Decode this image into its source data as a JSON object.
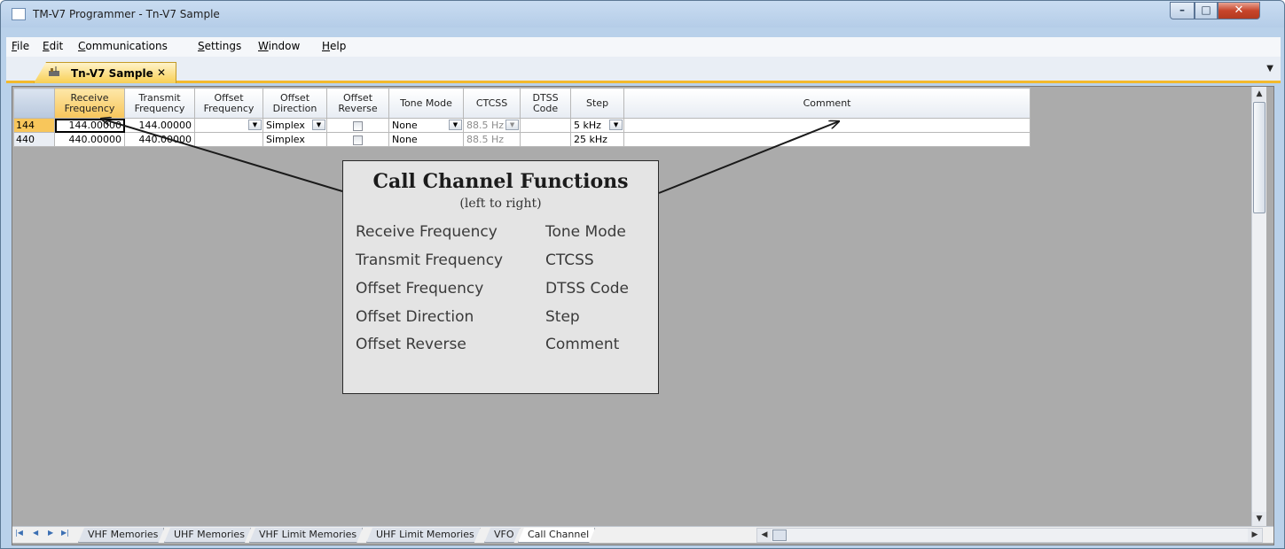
{
  "window": {
    "title": "TM-V7 Programmer - Tn-V7 Sample",
    "minimize_glyph": "–",
    "maximize_glyph": "□",
    "close_glyph": "✕"
  },
  "menu": [
    "File",
    "Edit",
    "Communications",
    "Settings",
    "Window",
    "Help"
  ],
  "document_tab": {
    "label": "Tn-V7 Sample",
    "close_glyph": "✕",
    "icon": "document-radio-icon"
  },
  "tab_dropdown_glyph": "▼",
  "grid": {
    "columns": [
      "Receive Frequency",
      "Transmit Frequency",
      "Offset Frequency",
      "Offset Direction",
      "Offset Reverse",
      "Tone Mode",
      "CTCSS",
      "DTSS Code",
      "Step",
      "Comment"
    ],
    "rows": [
      {
        "channel": "144",
        "receive": "144.00000",
        "transmit": "144.00000",
        "offset_freq": "",
        "offset_dir": "Simplex",
        "tone_mode": "None",
        "ctcss": "88.5 Hz",
        "dtss": "",
        "step": "5 kHz",
        "comment": ""
      },
      {
        "channel": "440",
        "receive": "440.00000",
        "transmit": "440.00000",
        "offset_freq": "",
        "offset_dir": "Simplex",
        "tone_mode": "None",
        "ctcss": "88.5 Hz",
        "dtss": "",
        "step": "25 kHz",
        "comment": ""
      }
    ]
  },
  "callout": {
    "title": "Call Channel Functions",
    "subtitle": "(left to right)",
    "left": [
      "Receive Frequency",
      "Transmit Frequency",
      "Offset Frequency",
      "Offset Direction",
      "Offset Reverse"
    ],
    "right": [
      "Tone Mode",
      "CTCSS",
      "DTSS Code",
      "Step",
      "Comment"
    ]
  },
  "sheet_tabs": [
    "VHF Memories",
    "UHF Memories",
    "VHF Limit Memories",
    "UHF Limit Memories",
    "VFO",
    "Call Channel"
  ],
  "active_sheet": "Call Channel",
  "scroll_glyphs": {
    "up": "▲",
    "down": "▼",
    "left": "◀",
    "right": "▶"
  },
  "sheet_nav_glyphs": [
    "|◀",
    "◀",
    "▶",
    "▶|"
  ],
  "colors": {
    "active_tab": "#f8cf53",
    "selected_header": "#f8c65b",
    "client_bg": "#ababab"
  }
}
